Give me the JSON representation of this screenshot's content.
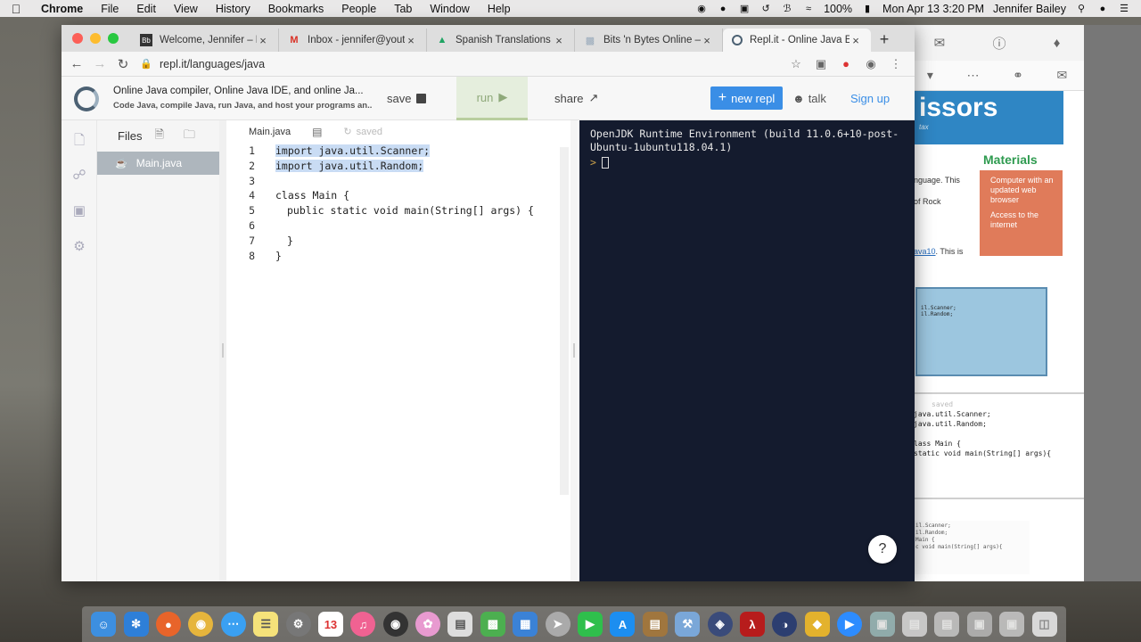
{
  "menubar": {
    "app": "Chrome",
    "items": [
      "File",
      "Edit",
      "View",
      "History",
      "Bookmarks",
      "People",
      "Tab",
      "Window",
      "Help"
    ],
    "battery": "100%",
    "clock": "Mon Apr 13  3:20 PM",
    "user": "Jennifer Bailey"
  },
  "browser": {
    "tabs": [
      {
        "title": "Welcome, Jennifer – Bla",
        "icon": "blackboard-icon"
      },
      {
        "title": "Inbox - jennifer@youthc",
        "icon": "gmail-icon"
      },
      {
        "title": "Spanish Translations - G",
        "icon": "drive-icon"
      },
      {
        "title": "Bits 'n Bytes Online — Yo",
        "icon": "site-icon"
      },
      {
        "title": "Repl.it - Online Java Edit",
        "icon": "replit-icon"
      }
    ],
    "url": "repl.it/languages/java"
  },
  "repl": {
    "title": "Online Java compiler, Online Java IDE, and online Ja...",
    "subtitle": "Code Java, compile Java, run Java, and host your programs an...",
    "save_label": "save",
    "run_label": "run",
    "share_label": "share",
    "new_repl_label": "new repl",
    "talk_label": "talk",
    "signup_label": "Sign up"
  },
  "files": {
    "header": "Files",
    "items": [
      "Main.java"
    ]
  },
  "editor": {
    "tab": "Main.java",
    "status": "saved",
    "line_numbers": [
      "1",
      "2",
      "3",
      "4",
      "5",
      "6",
      "7",
      "8"
    ],
    "lines": [
      "import java.util.Scanner;",
      "import java.util.Random;",
      "",
      "class Main {",
      "public static void main(String[] args) {",
      "",
      "}",
      "}"
    ]
  },
  "console": {
    "output": "OpenJDK Runtime Environment (build 11.0.6+10-post-Ubuntu-1ubuntu118.04.1)",
    "prompt": ">"
  },
  "help_label": "?",
  "background_window": {
    "banner": "issors",
    "banner_sub": "tax",
    "materials_heading": "Materials",
    "materials": [
      "Computer with an updated web browser",
      "Access to the internet"
    ],
    "text1": "nguage. This",
    "text2": "of Rock",
    "link": "ava10",
    "link_tail": ". This is",
    "code_lines": [
      "java.util.Scanner;",
      "java.util.Random;",
      "",
      "lass Main {",
      "  static void main(String[] args){"
    ],
    "code_small": [
      "il.Scanner;",
      "il.Random;",
      "",
      "Main {",
      "c void main(String[] args){"
    ],
    "saved": "saved"
  }
}
